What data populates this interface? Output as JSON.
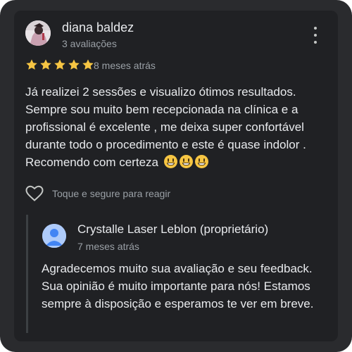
{
  "review": {
    "author": "diana baldez",
    "author_reviews": "3 avaliações",
    "rating": 5,
    "max_rating": 5,
    "time_ago": "8 meses atrás",
    "text": "Já realizei 2 sessões e visualizo ótimos resultados. Sempre sou muito bem recepcionada na clínica e a profissional é excelente , me deixa super confortável durante todo o procedimento e este é quase indolor . Recomendo com certeza",
    "emoji_count": 3,
    "react_label": "Toque e segure para reagir",
    "icons": {
      "menu": "more-vert-icon",
      "star": "star-icon",
      "like": "heart-outline-icon",
      "emoji": "grinning-face-emoji"
    }
  },
  "reply": {
    "owner_name": "Crystalle Laser Leblon (proprietário)",
    "time_ago": "7 meses atrás",
    "text": "Agradecemos muito sua avaliação e seu feedback. Sua opinião é muito importante para nós! Estamos sempre à disposição e esperamos te ver em breve.",
    "icons": {
      "avatar": "person-avatar-icon"
    }
  },
  "colors": {
    "background": "#2a2b2e",
    "card": "#202124",
    "star": "#f6c543",
    "text_primary": "#e8eaed",
    "text_secondary": "#9aa0a6",
    "owner_avatar": "#aecbfa"
  }
}
